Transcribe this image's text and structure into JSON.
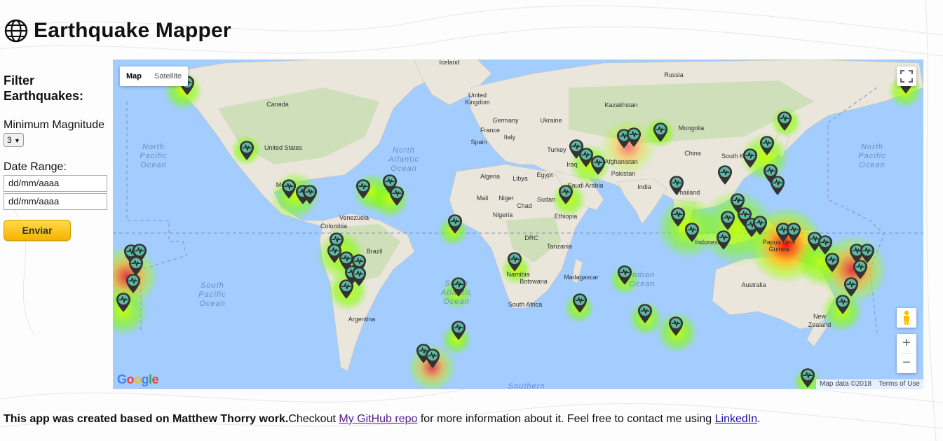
{
  "app": {
    "title": "Earthquake Mapper",
    "title_icon": "globe-icon"
  },
  "sidebar": {
    "filter_title": "Filter Earthquakes:",
    "min_magnitude_label": "Minimum Magnitude",
    "min_magnitude_value": "3",
    "date_range_label": "Date Range:",
    "date_from_placeholder": "dd/mm/aaaa",
    "date_to_placeholder": "dd/mm/aaaa",
    "submit_label": "Enviar"
  },
  "map": {
    "type_controls": {
      "map_label": "Map",
      "satellite_label": "Satellite",
      "active": "Map"
    },
    "labels": {
      "iceland": "Iceland",
      "russia": "Russia",
      "canada": "Canada",
      "uk": "United Kingdom",
      "kazakhstan": "Kazakhstan",
      "mongolia": "Mongolia",
      "germany": "Germany",
      "ukraine": "Ukraine",
      "france": "France",
      "spain": "Spain",
      "italy": "Italy",
      "turkey": "Turkey",
      "china": "China",
      "south_korea": "South Korea",
      "us": "United States",
      "afghanistan": "Afghanistan",
      "iraq": "Iraq",
      "pakistan": "Pakistan",
      "algeria": "Algeria",
      "libya": "Libya",
      "egypt": "Egypt",
      "saudi": "Saudi Arabia",
      "india": "India",
      "thailand": "Thailand",
      "mali": "Mali",
      "niger": "Niger",
      "chad": "Chad",
      "sudan": "Sudan",
      "nigeria": "Nigeria",
      "ethiopia": "Ethiopia",
      "mexico": "Mexico",
      "venezuela": "Venezuela",
      "colombia": "Colombia",
      "drc": "DRC",
      "tanzania": "Tanzania",
      "brazil": "Brazil",
      "indonesia": "Indonesia",
      "png": "Papua New Guinea",
      "namibia": "Namibia",
      "botswana": "Botswana",
      "madagascar": "Madagascar",
      "australia": "Australia",
      "south_africa": "South Africa",
      "argentina": "Argentina",
      "new_zealand": "New Zealand",
      "north_pacific": "North Pacific Ocean",
      "north_atlantic": "North Atlantic Ocean",
      "south_pacific": "South Pacific Ocean",
      "south_atlantic": "South Atlantic Ocean",
      "indian_ocean": "Indian Ocean",
      "southern": "Southern"
    },
    "google_logo": "Google",
    "map_data": "Map data ©2018",
    "terms": "Terms of Use",
    "colors": {
      "water": "#a3ccff",
      "land": "#eae6dc",
      "forest": "#c7ddb2",
      "heat_low": "#7fff00",
      "heat_high": "#ff0000",
      "marker": "#333333"
    }
  },
  "footer": {
    "bold_text": "This app was created based on Matthew Thorry work.",
    "text1": "Checkout ",
    "github_link": "My GitHub repo",
    "text2": " for more information about it. Feel free to contact me using ",
    "linkedin_link": "LinkedIn",
    "text3": "."
  }
}
